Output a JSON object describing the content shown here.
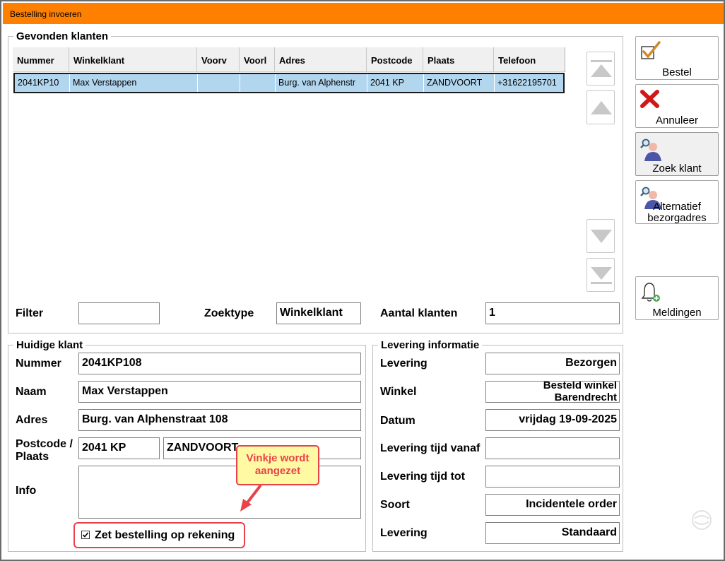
{
  "window": {
    "title": "Bestelling invoeren"
  },
  "found": {
    "title": "Gevonden klanten",
    "columns": [
      "Nummer",
      "Winkelklant",
      "Voorv",
      "Voorl",
      "Adres",
      "Postcode",
      "Plaats",
      "Telefoon"
    ],
    "rows": [
      {
        "nummer": "2041KP10",
        "winkelklant": "Max Verstappen",
        "voorv": "",
        "voorl": "",
        "adres": "Burg. van Alphenstr",
        "postcode": "2041 KP",
        "plaats": "ZANDVOORT",
        "telefoon": "+31622195701"
      }
    ],
    "filter_label": "Filter",
    "filter_value": "",
    "zoektype_label": "Zoektype",
    "zoektype_value": "Winkelklant",
    "aantal_label": "Aantal klanten",
    "aantal_value": "1"
  },
  "actions": {
    "bestel": "Bestel",
    "annuleer": "Annuleer",
    "zoek": "Zoek klant",
    "alternatief_1": "Alternatief",
    "alternatief_2": "bezorgadres",
    "meldingen": "Meldingen"
  },
  "klant": {
    "title": "Huidige klant",
    "nummer_label": "Nummer",
    "nummer": "2041KP108",
    "naam_label": "Naam",
    "naam": "Max Verstappen",
    "adres_label": "Adres",
    "adres": "Burg. van Alphenstraat 108",
    "postcode_label_1": "Postcode /",
    "postcode_label_2": "Plaats",
    "postcode": "2041 KP",
    "plaats": "ZANDVOORT",
    "info_label": "Info",
    "info": "",
    "checkbox_label": "Zet bestelling op rekening",
    "checkbox_checked": true
  },
  "levering": {
    "title": "Levering informatie",
    "levering_label": "Levering",
    "levering": "Bezorgen",
    "winkel_label": "Winkel",
    "winkel_1": "Besteld winkel",
    "winkel_2": "Barendrecht",
    "datum_label": "Datum",
    "datum": "vrijdag 19-09-2025",
    "vanaf_label": "Levering tijd vanaf",
    "vanaf": "",
    "tot_label": "Levering tijd tot",
    "tot": "",
    "soort_label": "Soort",
    "soort": "Incidentele order",
    "levering2_label": "Levering",
    "levering2": "Standaard"
  },
  "annotation": {
    "line1": "Vinkje wordt",
    "line2": "aangezet"
  },
  "colors": {
    "titlebar": "#ff8000",
    "selected_row": "#b3d6ef",
    "callout_border": "#e8424a",
    "callout_fill": "#fff9a3"
  }
}
